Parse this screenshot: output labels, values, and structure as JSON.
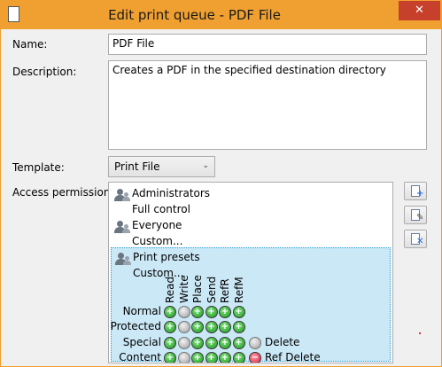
{
  "window": {
    "title": "Edit print queue - PDF File",
    "close_label": "✕"
  },
  "form": {
    "name_label": "Name:",
    "name_value": "PDF File",
    "description_label": "Description:",
    "description_value": "Creates a PDF in the specified destination directory",
    "template_label": "Template:",
    "template_value": "Print File",
    "access_label": "Access permissions:"
  },
  "permissions": {
    "entries": [
      {
        "who": "Administrators",
        "level": "Full control"
      },
      {
        "who": "Everyone",
        "level": "Custom..."
      },
      {
        "who": "Print presets",
        "level": "Custom..."
      }
    ],
    "matrix": {
      "columns": [
        "Read",
        "Write",
        "Place",
        "Send",
        "RefR",
        "RefM"
      ],
      "rows": [
        {
          "label": "Normal",
          "cells": [
            "green",
            "gray",
            "green",
            "green",
            "green",
            "green"
          ],
          "extra": []
        },
        {
          "label": "Protected",
          "cells": [
            "green",
            "gray",
            "green",
            "green",
            "green",
            "green"
          ],
          "extra": []
        },
        {
          "label": "Special",
          "cells": [
            "green",
            "gray",
            "green",
            "green",
            "green",
            "green"
          ],
          "extra": [
            {
              "state": "gray",
              "label": "Delete"
            }
          ]
        },
        {
          "label": "Content",
          "cells": [
            "green",
            "gray",
            "green",
            "green",
            "green",
            "green"
          ],
          "extra": [
            {
              "state": "red",
              "label": "Ref Delete"
            }
          ]
        }
      ]
    }
  },
  "side_buttons": [
    {
      "name": "add-permission-button",
      "mark": "+",
      "mark_color": "#2a6fd6"
    },
    {
      "name": "edit-permission-button",
      "mark": "✎",
      "mark_color": "#555555"
    },
    {
      "name": "remove-permission-button",
      "mark": "✕",
      "mark_color": "#2a6fd6"
    }
  ]
}
